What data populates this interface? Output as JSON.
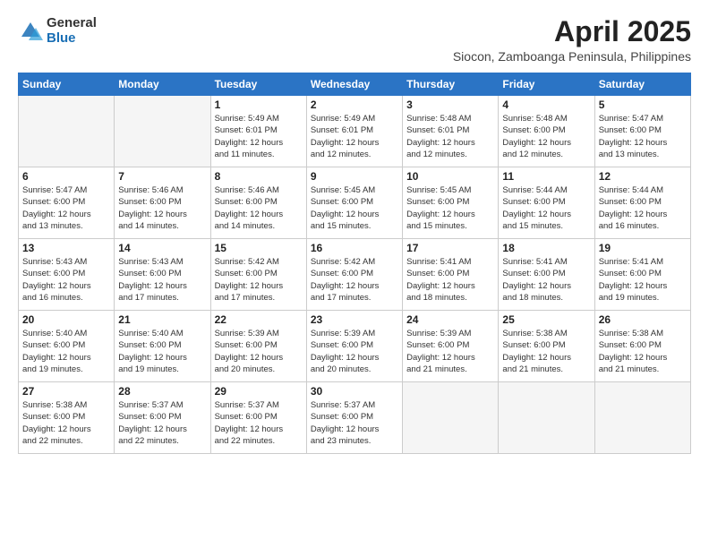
{
  "header": {
    "logo_general": "General",
    "logo_blue": "Blue",
    "title": "April 2025",
    "subtitle": "Siocon, Zamboanga Peninsula, Philippines"
  },
  "weekdays": [
    "Sunday",
    "Monday",
    "Tuesday",
    "Wednesday",
    "Thursday",
    "Friday",
    "Saturday"
  ],
  "weeks": [
    [
      {
        "day": "",
        "info": ""
      },
      {
        "day": "",
        "info": ""
      },
      {
        "day": "1",
        "info": "Sunrise: 5:49 AM\nSunset: 6:01 PM\nDaylight: 12 hours\nand 11 minutes."
      },
      {
        "day": "2",
        "info": "Sunrise: 5:49 AM\nSunset: 6:01 PM\nDaylight: 12 hours\nand 12 minutes."
      },
      {
        "day": "3",
        "info": "Sunrise: 5:48 AM\nSunset: 6:01 PM\nDaylight: 12 hours\nand 12 minutes."
      },
      {
        "day": "4",
        "info": "Sunrise: 5:48 AM\nSunset: 6:00 PM\nDaylight: 12 hours\nand 12 minutes."
      },
      {
        "day": "5",
        "info": "Sunrise: 5:47 AM\nSunset: 6:00 PM\nDaylight: 12 hours\nand 13 minutes."
      }
    ],
    [
      {
        "day": "6",
        "info": "Sunrise: 5:47 AM\nSunset: 6:00 PM\nDaylight: 12 hours\nand 13 minutes."
      },
      {
        "day": "7",
        "info": "Sunrise: 5:46 AM\nSunset: 6:00 PM\nDaylight: 12 hours\nand 14 minutes."
      },
      {
        "day": "8",
        "info": "Sunrise: 5:46 AM\nSunset: 6:00 PM\nDaylight: 12 hours\nand 14 minutes."
      },
      {
        "day": "9",
        "info": "Sunrise: 5:45 AM\nSunset: 6:00 PM\nDaylight: 12 hours\nand 15 minutes."
      },
      {
        "day": "10",
        "info": "Sunrise: 5:45 AM\nSunset: 6:00 PM\nDaylight: 12 hours\nand 15 minutes."
      },
      {
        "day": "11",
        "info": "Sunrise: 5:44 AM\nSunset: 6:00 PM\nDaylight: 12 hours\nand 15 minutes."
      },
      {
        "day": "12",
        "info": "Sunrise: 5:44 AM\nSunset: 6:00 PM\nDaylight: 12 hours\nand 16 minutes."
      }
    ],
    [
      {
        "day": "13",
        "info": "Sunrise: 5:43 AM\nSunset: 6:00 PM\nDaylight: 12 hours\nand 16 minutes."
      },
      {
        "day": "14",
        "info": "Sunrise: 5:43 AM\nSunset: 6:00 PM\nDaylight: 12 hours\nand 17 minutes."
      },
      {
        "day": "15",
        "info": "Sunrise: 5:42 AM\nSunset: 6:00 PM\nDaylight: 12 hours\nand 17 minutes."
      },
      {
        "day": "16",
        "info": "Sunrise: 5:42 AM\nSunset: 6:00 PM\nDaylight: 12 hours\nand 17 minutes."
      },
      {
        "day": "17",
        "info": "Sunrise: 5:41 AM\nSunset: 6:00 PM\nDaylight: 12 hours\nand 18 minutes."
      },
      {
        "day": "18",
        "info": "Sunrise: 5:41 AM\nSunset: 6:00 PM\nDaylight: 12 hours\nand 18 minutes."
      },
      {
        "day": "19",
        "info": "Sunrise: 5:41 AM\nSunset: 6:00 PM\nDaylight: 12 hours\nand 19 minutes."
      }
    ],
    [
      {
        "day": "20",
        "info": "Sunrise: 5:40 AM\nSunset: 6:00 PM\nDaylight: 12 hours\nand 19 minutes."
      },
      {
        "day": "21",
        "info": "Sunrise: 5:40 AM\nSunset: 6:00 PM\nDaylight: 12 hours\nand 19 minutes."
      },
      {
        "day": "22",
        "info": "Sunrise: 5:39 AM\nSunset: 6:00 PM\nDaylight: 12 hours\nand 20 minutes."
      },
      {
        "day": "23",
        "info": "Sunrise: 5:39 AM\nSunset: 6:00 PM\nDaylight: 12 hours\nand 20 minutes."
      },
      {
        "day": "24",
        "info": "Sunrise: 5:39 AM\nSunset: 6:00 PM\nDaylight: 12 hours\nand 21 minutes."
      },
      {
        "day": "25",
        "info": "Sunrise: 5:38 AM\nSunset: 6:00 PM\nDaylight: 12 hours\nand 21 minutes."
      },
      {
        "day": "26",
        "info": "Sunrise: 5:38 AM\nSunset: 6:00 PM\nDaylight: 12 hours\nand 21 minutes."
      }
    ],
    [
      {
        "day": "27",
        "info": "Sunrise: 5:38 AM\nSunset: 6:00 PM\nDaylight: 12 hours\nand 22 minutes."
      },
      {
        "day": "28",
        "info": "Sunrise: 5:37 AM\nSunset: 6:00 PM\nDaylight: 12 hours\nand 22 minutes."
      },
      {
        "day": "29",
        "info": "Sunrise: 5:37 AM\nSunset: 6:00 PM\nDaylight: 12 hours\nand 22 minutes."
      },
      {
        "day": "30",
        "info": "Sunrise: 5:37 AM\nSunset: 6:00 PM\nDaylight: 12 hours\nand 23 minutes."
      },
      {
        "day": "",
        "info": ""
      },
      {
        "day": "",
        "info": ""
      },
      {
        "day": "",
        "info": ""
      }
    ]
  ]
}
